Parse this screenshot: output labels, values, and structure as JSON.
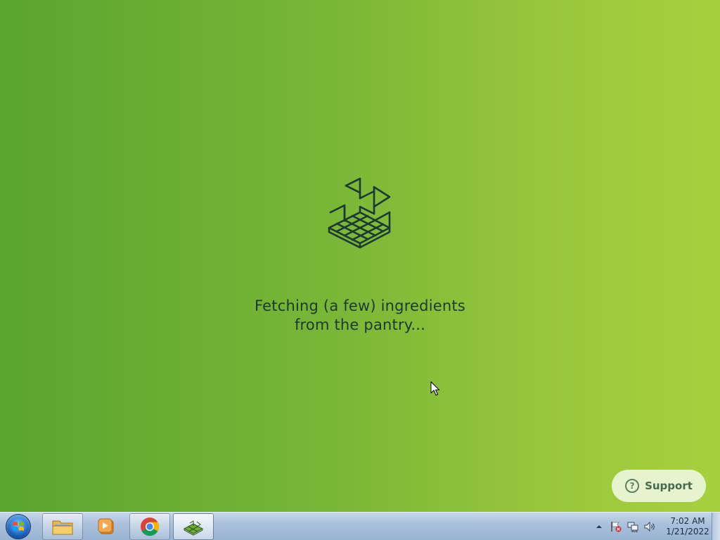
{
  "app": {
    "loading_line1": "Fetching (a few) ingredients",
    "loading_line2": "from the pantry...",
    "support_label": "Support",
    "help_icon_glyph": "?",
    "logo_icon": "crate-cube-logo-icon",
    "background_colors": [
      "#5aa52f",
      "#a8d03e"
    ],
    "text_color": "#1d3a30"
  },
  "taskbar": {
    "start_icon": "windows-start-orb-icon",
    "items": [
      {
        "name": "file-explorer",
        "icon": "folder-icon"
      },
      {
        "name": "media-player",
        "icon": "play-icon"
      },
      {
        "name": "chrome",
        "icon": "chrome-icon"
      },
      {
        "name": "app",
        "icon": "crate-cube-logo-icon",
        "active": true
      }
    ],
    "tray": {
      "icons": [
        "tray-expand-icon",
        "action-center-flag-icon",
        "network-icon",
        "volume-icon"
      ],
      "time": "7:02 AM",
      "date": "1/21/2022"
    }
  }
}
